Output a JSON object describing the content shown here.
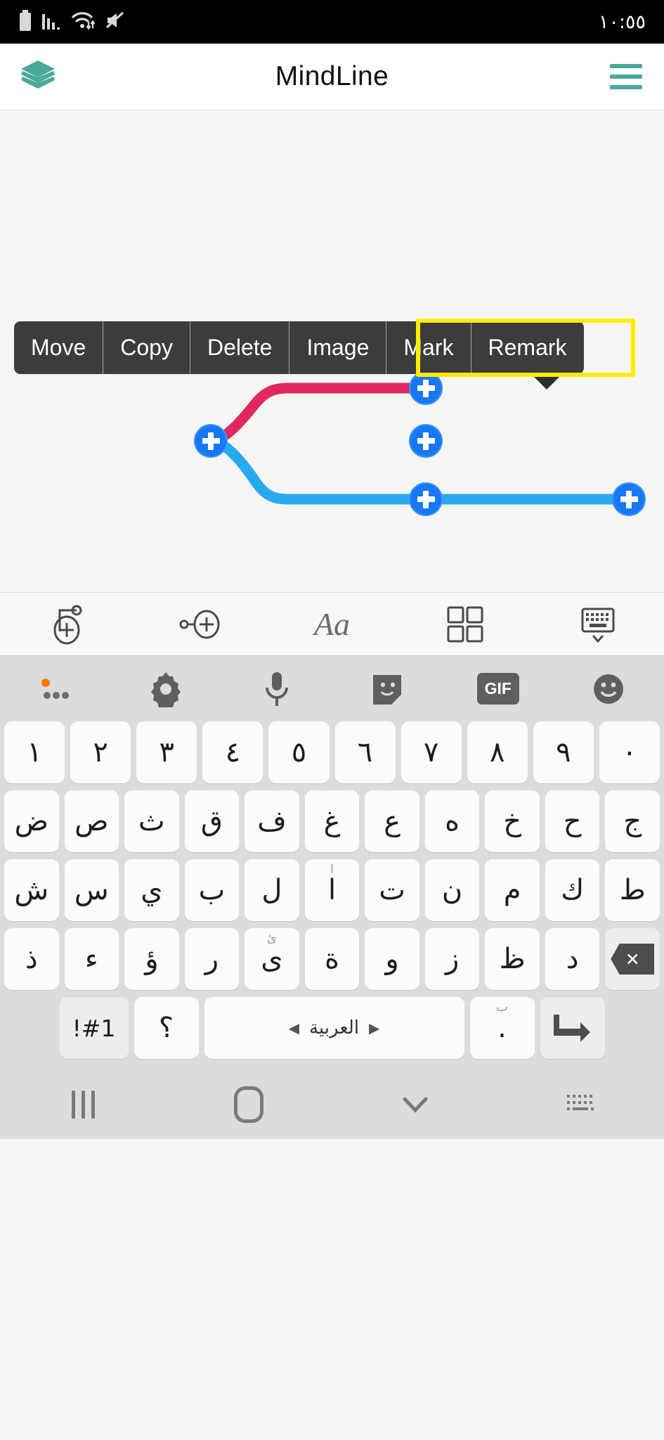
{
  "status_bar": {
    "time": "١٠:٥٥",
    "icons": [
      "battery-icon",
      "signal-bars-icon",
      "wifi-icon",
      "mute-icon"
    ],
    "background": "#000000"
  },
  "header": {
    "title": "MindLine",
    "logo_icon": "layers-stack-icon",
    "menu_icon": "hamburger-menu-icon",
    "accent_color": "#4aa99a",
    "background": "#ffffff"
  },
  "canvas": {
    "background": "#f5f6f4",
    "branches": [
      {
        "name": "upper-branch",
        "color": "#e0285f"
      },
      {
        "name": "lower-branch",
        "color": "#29a9ee"
      }
    ],
    "nodes": [
      {
        "name": "add-node-upper-right",
        "icon": "plus-circle-icon",
        "color": "#1877f2"
      },
      {
        "name": "add-node-center",
        "icon": "plus-circle-icon",
        "color": "#1877f2"
      },
      {
        "name": "add-node-lower-middle",
        "icon": "plus-circle-icon",
        "color": "#1877f2"
      },
      {
        "name": "add-node-lower-right",
        "icon": "plus-circle-icon",
        "color": "#1877f2"
      },
      {
        "name": "add-node-lower-left-hidden",
        "icon": "plus-circle-icon",
        "color": "#1877f2"
      }
    ]
  },
  "context_menu": {
    "background": "rgba(45,45,45,0.93)",
    "highlight_color": "#ffed00",
    "items": [
      {
        "label": "Move",
        "highlighted": false
      },
      {
        "label": "Copy",
        "highlighted": false
      },
      {
        "label": "Delete",
        "highlighted": false
      },
      {
        "label": "Image",
        "highlighted": false
      },
      {
        "label": "Mark",
        "highlighted": true
      },
      {
        "label": "Remark",
        "highlighted": true
      }
    ]
  },
  "mind_toolbar": {
    "background": "#f7f8f6",
    "items": [
      {
        "name": "add-sibling-node-icon",
        "label": "add-sibling-node"
      },
      {
        "name": "add-child-node-icon",
        "label": "add-child-node"
      },
      {
        "name": "text-format-icon",
        "label": "Aa"
      },
      {
        "name": "layout-grid-icon",
        "label": "layout"
      },
      {
        "name": "hide-keyboard-icon",
        "label": "keyboard"
      }
    ]
  },
  "keyboard": {
    "background": "#dcdcdc",
    "key_background": "#fbfbfb",
    "toolbar": [
      {
        "name": "more-options-icon",
        "label": "...",
        "badge": true,
        "badge_color": "#ff7b00"
      },
      {
        "name": "settings-gear-icon",
        "label": "settings"
      },
      {
        "name": "microphone-icon",
        "label": "voice-input"
      },
      {
        "name": "sticker-icon",
        "label": "stickers"
      },
      {
        "name": "gif-icon",
        "label": "GIF"
      },
      {
        "name": "emoji-icon",
        "label": "emoji"
      }
    ],
    "rows": [
      {
        "name": "number-row",
        "keys": [
          {
            "label": "١"
          },
          {
            "label": "٢"
          },
          {
            "label": "٣"
          },
          {
            "label": "٤"
          },
          {
            "label": "٥"
          },
          {
            "label": "٦"
          },
          {
            "label": "٧"
          },
          {
            "label": "٨"
          },
          {
            "label": "٩"
          },
          {
            "label": "٠"
          }
        ]
      },
      {
        "name": "letter-row-1",
        "keys": [
          {
            "label": "ض"
          },
          {
            "label": "ص"
          },
          {
            "label": "ث"
          },
          {
            "label": "ق"
          },
          {
            "label": "ف"
          },
          {
            "label": "غ"
          },
          {
            "label": "ع"
          },
          {
            "label": "ه"
          },
          {
            "label": "خ"
          },
          {
            "label": "ح"
          },
          {
            "label": "ج"
          }
        ]
      },
      {
        "name": "letter-row-2",
        "keys": [
          {
            "label": "ش"
          },
          {
            "label": "س"
          },
          {
            "label": "ي"
          },
          {
            "label": "ب"
          },
          {
            "label": "ل"
          },
          {
            "label": "ا",
            "sup": "ا"
          },
          {
            "label": "ت"
          },
          {
            "label": "ن"
          },
          {
            "label": "م"
          },
          {
            "label": "ك"
          },
          {
            "label": "ط"
          }
        ]
      },
      {
        "name": "letter-row-3",
        "keys": [
          {
            "label": "ذ"
          },
          {
            "label": "ء"
          },
          {
            "label": "ؤ"
          },
          {
            "label": "ر"
          },
          {
            "label": "ى",
            "sup": "ئ"
          },
          {
            "label": "ة"
          },
          {
            "label": "و"
          },
          {
            "label": "ز"
          },
          {
            "label": "ظ"
          },
          {
            "label": "د"
          }
        ],
        "backspace": "✕"
      }
    ],
    "bottom_row": {
      "symbols_key": "!#1",
      "question_key": "؟",
      "space_key": "العربية",
      "space_arrow_left": "◀",
      "space_arrow_right": "▶",
      "period_key": ".",
      "period_sup": "ب",
      "enter_key": "enter-arrow-icon"
    }
  },
  "nav_bar": {
    "background": "#dcdcdc",
    "items": [
      {
        "name": "recents-button",
        "label": "recents"
      },
      {
        "name": "home-button",
        "label": "home"
      },
      {
        "name": "hide-keyboard-button",
        "label": "hide-keyboard"
      },
      {
        "name": "keyboard-switch-button",
        "label": "switch-keyboard"
      }
    ]
  }
}
